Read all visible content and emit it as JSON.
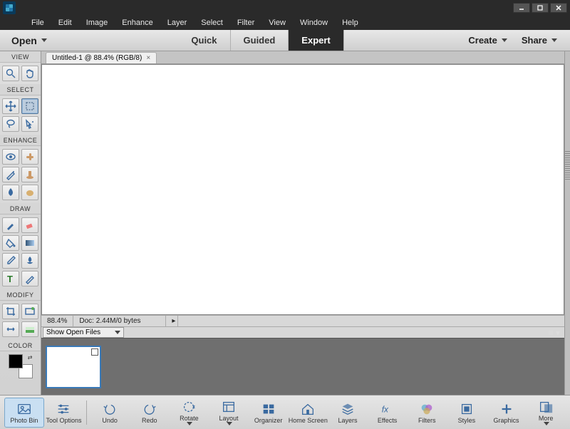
{
  "window": {
    "min_tip": "Minimize",
    "max_tip": "Maximize",
    "close_tip": "Close"
  },
  "menu": {
    "items": [
      "File",
      "Edit",
      "Image",
      "Enhance",
      "Layer",
      "Select",
      "Filter",
      "View",
      "Window",
      "Help"
    ]
  },
  "modebar": {
    "open": "Open",
    "tabs": [
      "Quick",
      "Guided",
      "Expert"
    ],
    "active_tab": "Expert",
    "create": "Create",
    "share": "Share"
  },
  "toolbox": {
    "sections": {
      "view": "VIEW",
      "select": "SELECT",
      "enhance": "ENHANCE",
      "draw": "DRAW",
      "modify": "MODIFY",
      "color": "COLOR"
    }
  },
  "document": {
    "tab_label": "Untitled-1 @ 88.4% (RGB/8)"
  },
  "status": {
    "zoom": "88.4%",
    "doc_info": "Doc: 2.44M/0 bytes"
  },
  "photobin": {
    "dropdown": "Show Open Files"
  },
  "bottombar": {
    "left": [
      {
        "key": "photo_bin",
        "label": "Photo Bin"
      },
      {
        "key": "tool_options",
        "label": "Tool Options"
      }
    ],
    "mid": [
      {
        "key": "undo",
        "label": "Undo"
      },
      {
        "key": "redo",
        "label": "Redo"
      },
      {
        "key": "rotate",
        "label": "Rotate"
      },
      {
        "key": "layout",
        "label": "Layout"
      },
      {
        "key": "organizer",
        "label": "Organizer"
      },
      {
        "key": "home",
        "label": "Home Screen"
      }
    ],
    "right": [
      {
        "key": "layers",
        "label": "Layers"
      },
      {
        "key": "effects",
        "label": "Effects"
      },
      {
        "key": "filters",
        "label": "Filters"
      },
      {
        "key": "styles",
        "label": "Styles"
      },
      {
        "key": "graphics",
        "label": "Graphics"
      },
      {
        "key": "more",
        "label": "More"
      }
    ]
  }
}
